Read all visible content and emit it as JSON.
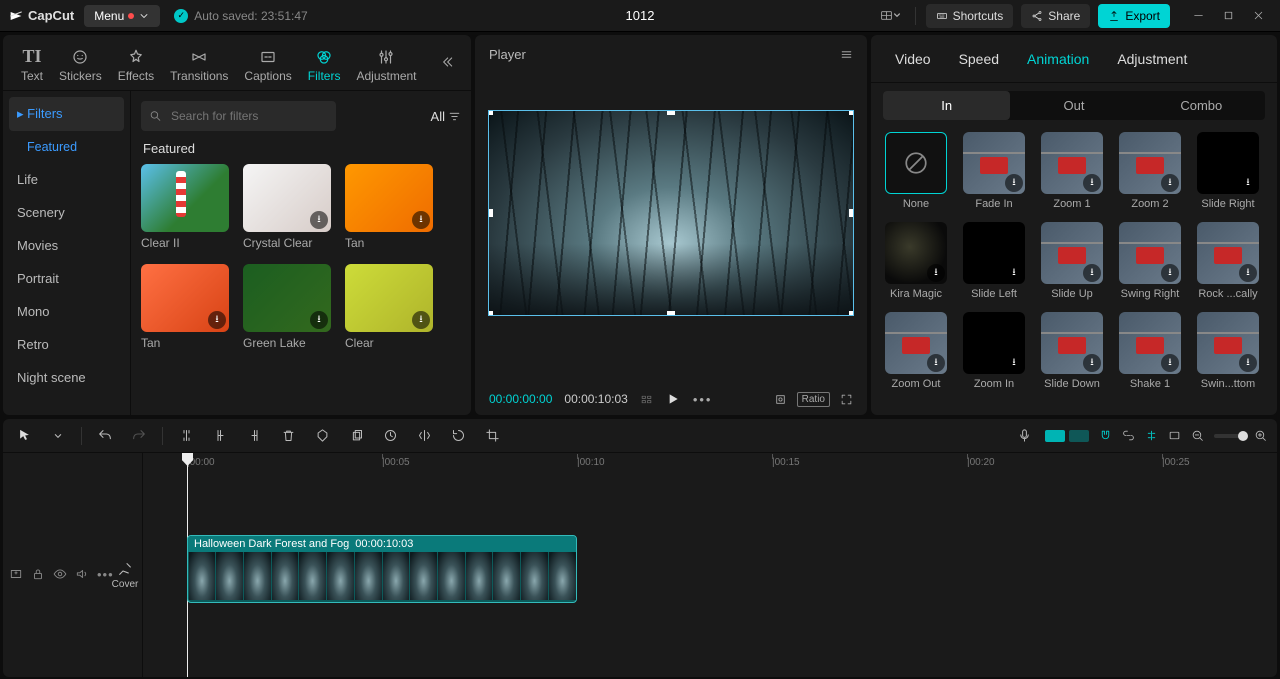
{
  "app": {
    "name": "CapCut",
    "menu_label": "Menu",
    "auto_saved_label": "Auto saved: 23:51:47",
    "project_title": "1012"
  },
  "header": {
    "shortcuts": "Shortcuts",
    "share": "Share",
    "export": "Export"
  },
  "media_tabs": {
    "text": "Text",
    "stickers": "Stickers",
    "effects": "Effects",
    "transitions": "Transitions",
    "captions": "Captions",
    "filters": "Filters",
    "adjustment": "Adjustment"
  },
  "filters_panel": {
    "search_placeholder": "Search for filters",
    "all_label": "All",
    "categories": {
      "filters": "Filters",
      "featured": "Featured",
      "life": "Life",
      "scenery": "Scenery",
      "movies": "Movies",
      "portrait": "Portrait",
      "mono": "Mono",
      "retro": "Retro",
      "night": "Night scene"
    },
    "section_label": "Featured",
    "items": [
      {
        "name": "Clear II"
      },
      {
        "name": "Crystal Clear"
      },
      {
        "name": "Tan"
      },
      {
        "name": "Tan"
      },
      {
        "name": "Green Lake"
      },
      {
        "name": "Clear"
      }
    ]
  },
  "player": {
    "label": "Player",
    "current_time": "00:00:00:00",
    "duration": "00:00:10:03",
    "ratio_label": "Ratio"
  },
  "inspector": {
    "tabs": {
      "video": "Video",
      "speed": "Speed",
      "animation": "Animation",
      "adjustment": "Adjustment"
    },
    "anim_modes": {
      "in": "In",
      "out": "Out",
      "combo": "Combo"
    },
    "animations": [
      {
        "name": "None",
        "kind": "none"
      },
      {
        "name": "Fade In",
        "kind": "cable"
      },
      {
        "name": "Zoom 1",
        "kind": "cable"
      },
      {
        "name": "Zoom 2",
        "kind": "cable"
      },
      {
        "name": "Slide Right",
        "kind": "black"
      },
      {
        "name": "Kira Magic",
        "kind": "dark"
      },
      {
        "name": "Slide Left",
        "kind": "black"
      },
      {
        "name": "Slide Up",
        "kind": "cable"
      },
      {
        "name": "Swing Right",
        "kind": "cable"
      },
      {
        "name": "Rock ...cally",
        "kind": "cable"
      },
      {
        "name": "Zoom Out",
        "kind": "cable"
      },
      {
        "name": "Zoom In",
        "kind": "black"
      },
      {
        "name": "Slide Down",
        "kind": "cable"
      },
      {
        "name": "Shake 1",
        "kind": "cable"
      },
      {
        "name": "Swin...ttom",
        "kind": "cable"
      }
    ]
  },
  "timeline": {
    "cover": "Cover",
    "clip_name": "Halloween Dark Forest and Fog",
    "clip_duration": "00:00:10:03",
    "marks": [
      "00:00",
      "00:05",
      "00:10",
      "00:15",
      "00:20",
      "00:25"
    ]
  }
}
